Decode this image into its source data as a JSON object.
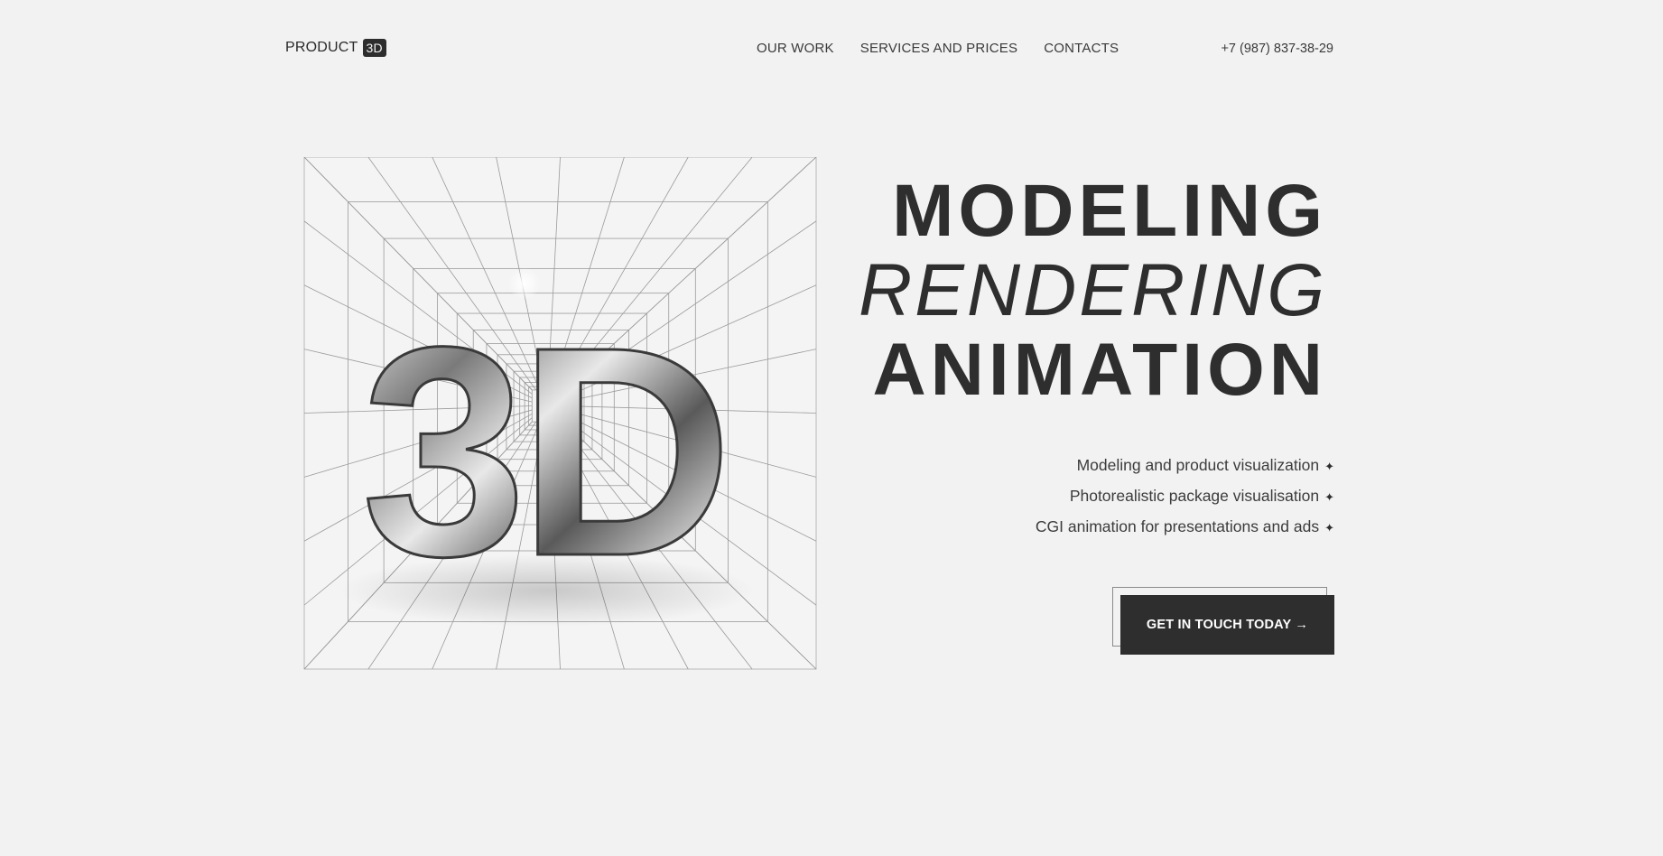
{
  "header": {
    "logo_text": "PRODUCT",
    "logo_badge": "3D",
    "nav": [
      {
        "label": "OUR WORK"
      },
      {
        "label": "SERVICES AND PRICES"
      },
      {
        "label": "CONTACTS"
      }
    ],
    "phone": "+7 (987) 837-38-29"
  },
  "hero": {
    "image_text": "3D",
    "headline": [
      "MODELING",
      "RENDERING",
      "ANIMATION"
    ],
    "features": [
      "Modeling and product visualization",
      "Photorealistic package visualisation",
      "CGI animation for presentations and ads"
    ],
    "feature_icon": "sparkle-icon",
    "cta_label": "GET IN TOUCH TODAY",
    "cta_icon": "arrow-right-icon"
  },
  "colors": {
    "background": "#f2f2f2",
    "text": "#2e2e2e",
    "button": "#2e2e2e",
    "button_text": "#ffffff"
  }
}
